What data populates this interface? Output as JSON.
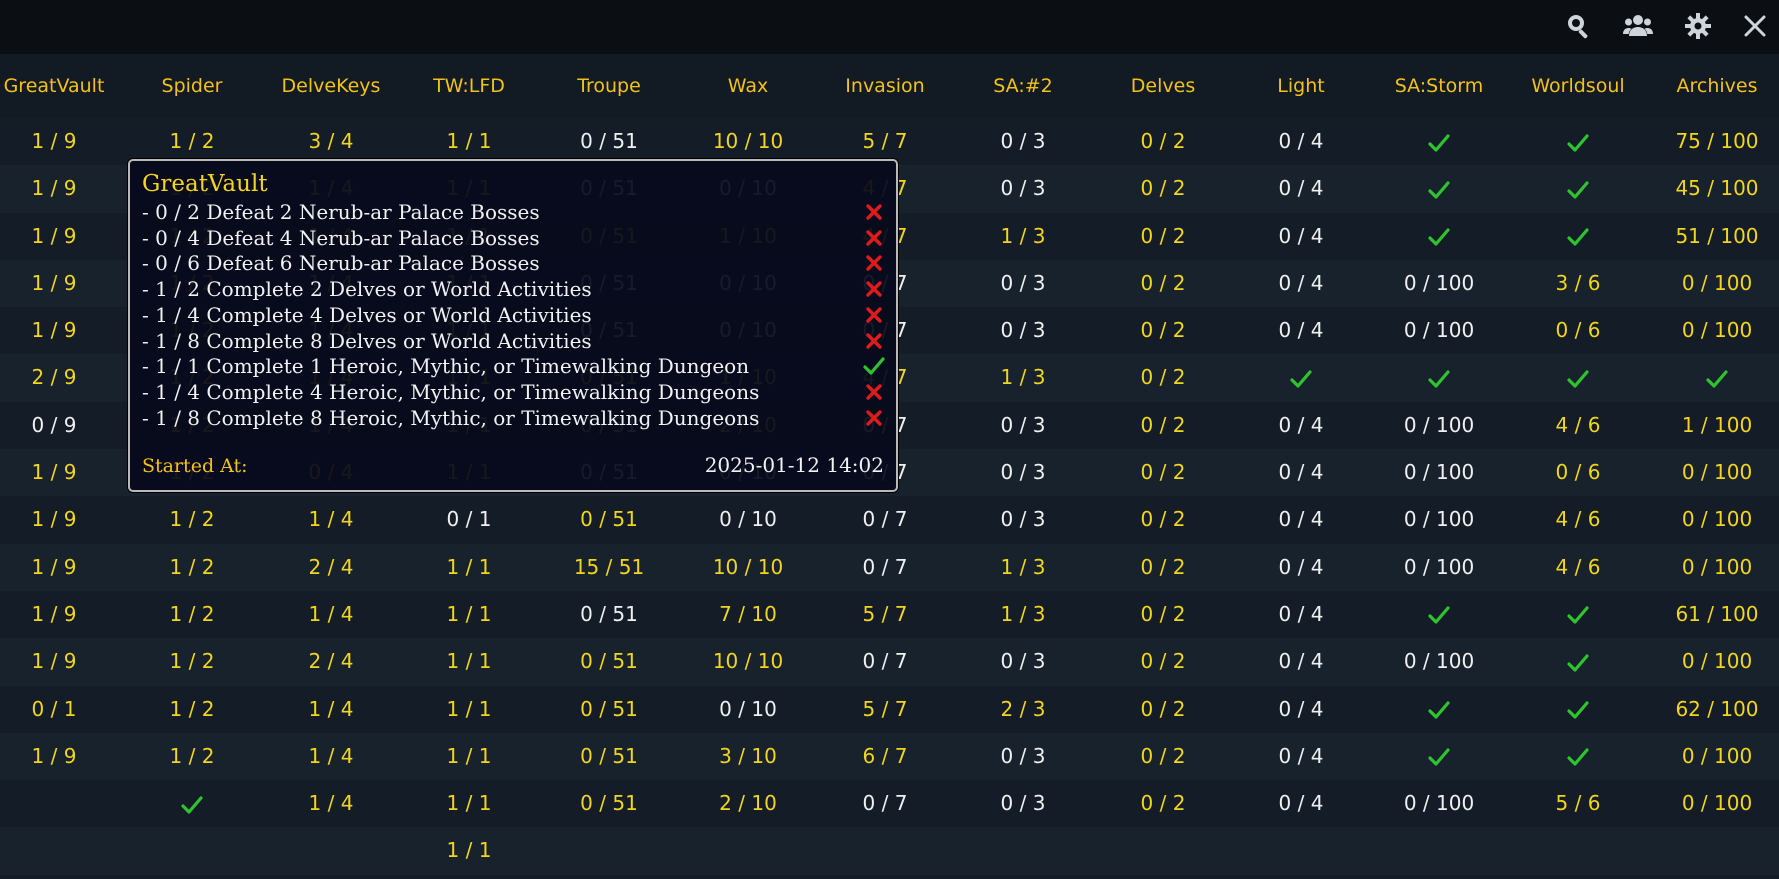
{
  "toolbar": {
    "icons": [
      "search-icon",
      "group-icon",
      "gear-icon",
      "close-icon"
    ]
  },
  "columns": [
    "GreatVault",
    "Spider",
    "DelveKeys",
    "TW:LFD",
    "Troupe",
    "Wax",
    "Invasion",
    "SA:#2",
    "Delves",
    "Light",
    "SA:Storm",
    "Worldsoul",
    "Archives"
  ],
  "rows": [
    [
      "y:1 / 9",
      "y:1 / 2",
      "y:3 / 4",
      "y:1 / 1",
      "w:0 / 51",
      "y:10 / 10",
      "y:5 / 7",
      "w:0 / 3",
      "y:0 / 2",
      "w:0 / 4",
      "check",
      "check",
      "y:75 / 100"
    ],
    [
      "y:1 / 9",
      "y:1 / 2",
      "y:1 / 4",
      "y:1 / 1",
      "w:0 / 51",
      "w:0 / 10",
      "y:4 / 7",
      "w:0 / 3",
      "y:0 / 2",
      "w:0 / 4",
      "check",
      "check",
      "y:45 / 100"
    ],
    [
      "y:1 / 9",
      "y:1 / 2",
      "y:1 / 4",
      "y:1 / 1",
      "y:0 / 51",
      "y:1 / 10",
      "y:4 / 7",
      "y:1 / 3",
      "y:0 / 2",
      "w:0 / 4",
      "check",
      "check",
      "y:51 / 100"
    ],
    [
      "y:1 / 9",
      "y:1 / 2",
      "y:1 / 4",
      "y:1 / 1",
      "w:0 / 51",
      "w:0 / 10",
      "w:0 / 7",
      "w:0 / 3",
      "y:0 / 2",
      "w:0 / 4",
      "w:0 / 100",
      "y:3 / 6",
      "y:0 / 100"
    ],
    [
      "y:1 / 9",
      "y:1 / 2",
      "y:1 / 4",
      "y:1 / 1",
      "w:0 / 51",
      "w:0 / 10",
      "w:0 / 7",
      "w:0 / 3",
      "y:0 / 2",
      "w:0 / 4",
      "w:0 / 100",
      "y:0 / 6",
      "y:0 / 100"
    ],
    [
      "y:2 / 9",
      "y:1 / 2",
      "y:1 / 4",
      "y:1 / 1",
      "y:0 / 51",
      "y:1 / 10",
      "y:4 / 7",
      "y:1 / 3",
      "y:0 / 2",
      "check",
      "check",
      "check",
      "check"
    ],
    [
      "w:0 / 9",
      "y:1 / 2",
      "y:1 / 4",
      "y:1 / 1",
      "w:0 / 51",
      "y:2 / 10",
      "w:0 / 7",
      "w:0 / 3",
      "y:0 / 2",
      "w:0 / 4",
      "w:0 / 100",
      "y:4 / 6",
      "y:1 / 100"
    ],
    [
      "y:1 / 9",
      "y:1 / 2",
      "y:0 / 4",
      "y:1 / 1",
      "w:0 / 51",
      "w:0 / 10",
      "w:0 / 7",
      "w:0 / 3",
      "y:0 / 2",
      "w:0 / 4",
      "w:0 / 100",
      "y:0 / 6",
      "y:0 / 100"
    ],
    [
      "y:1 / 9",
      "y:1 / 2",
      "y:1 / 4",
      "w:0 / 1",
      "y:0 / 51",
      "w:0 / 10",
      "w:0 / 7",
      "w:0 / 3",
      "y:0 / 2",
      "w:0 / 4",
      "w:0 / 100",
      "y:4 / 6",
      "y:0 / 100"
    ],
    [
      "y:1 / 9",
      "y:1 / 2",
      "y:2 / 4",
      "y:1 / 1",
      "y:15 / 51",
      "y:10 / 10",
      "w:0 / 7",
      "y:1 / 3",
      "y:0 / 2",
      "w:0 / 4",
      "w:0 / 100",
      "y:4 / 6",
      "y:0 / 100"
    ],
    [
      "y:1 / 9",
      "y:1 / 2",
      "y:1 / 4",
      "y:1 / 1",
      "w:0 / 51",
      "y:7 / 10",
      "y:5 / 7",
      "y:1 / 3",
      "y:0 / 2",
      "w:0 / 4",
      "check",
      "check",
      "y:61 / 100"
    ],
    [
      "y:1 / 9",
      "y:1 / 2",
      "y:2 / 4",
      "y:1 / 1",
      "y:0 / 51",
      "y:10 / 10",
      "w:0 / 7",
      "w:0 / 3",
      "y:0 / 2",
      "w:0 / 4",
      "w:0 / 100",
      "check",
      "y:0 / 100"
    ],
    [
      "y:0 / 1",
      "y:1 / 2",
      "y:1 / 4",
      "y:1 / 1",
      "y:0 / 51",
      "w:0 / 10",
      "y:5 / 7",
      "y:2 / 3",
      "y:0 / 2",
      "w:0 / 4",
      "check",
      "check",
      "y:62 / 100"
    ],
    [
      "y:1 / 9",
      "y:1 / 2",
      "y:1 / 4",
      "y:1 / 1",
      "y:0 / 51",
      "y:3 / 10",
      "y:6 / 7",
      "w:0 / 3",
      "y:0 / 2",
      "w:0 / 4",
      "check",
      "check",
      "y:0 / 100"
    ],
    [
      "",
      "check",
      "y:1 / 4",
      "y:1 / 1",
      "y:0 / 51",
      "y:2 / 10",
      "w:0 / 7",
      "w:0 / 3",
      "y:0 / 2",
      "w:0 / 4",
      "w:0 / 100",
      "y:5 / 6",
      "y:0 / 100"
    ],
    [
      "",
      "",
      "",
      "y:1 / 1",
      "",
      "",
      "",
      "",
      "",
      "",
      "",
      "",
      ""
    ]
  ],
  "tooltip": {
    "title": "GreatVault",
    "lines": [
      {
        "text": "- 0 / 2 Defeat 2 Nerub-ar Palace Bosses",
        "status": "cross"
      },
      {
        "text": "- 0 / 4 Defeat 4 Nerub-ar Palace Bosses",
        "status": "cross"
      },
      {
        "text": "- 0 / 6 Defeat 6 Nerub-ar Palace Bosses",
        "status": "cross"
      },
      {
        "text": "- 1 / 2 Complete 2 Delves or World Activities",
        "status": "cross"
      },
      {
        "text": "- 1 / 4 Complete 4 Delves or World Activities",
        "status": "cross"
      },
      {
        "text": "- 1 / 8 Complete 8 Delves or World Activities",
        "status": "cross"
      },
      {
        "text": "- 1 / 1 Complete 1 Heroic, Mythic, or Timewalking Dungeon",
        "status": "check"
      },
      {
        "text": "- 1 / 4 Complete 4 Heroic, Mythic, or Timewalking Dungeons",
        "status": "cross"
      },
      {
        "text": "- 1 / 8 Complete 8 Heroic, Mythic, or Timewalking Dungeons",
        "status": "cross"
      }
    ],
    "started_label": "Started At:",
    "started_value": "2025-01-12 14:02"
  },
  "colors": {
    "yellow": "#f2d51e",
    "white": "#f0f0f0",
    "check": "#2fc42f",
    "cross": "#e01b1b"
  }
}
